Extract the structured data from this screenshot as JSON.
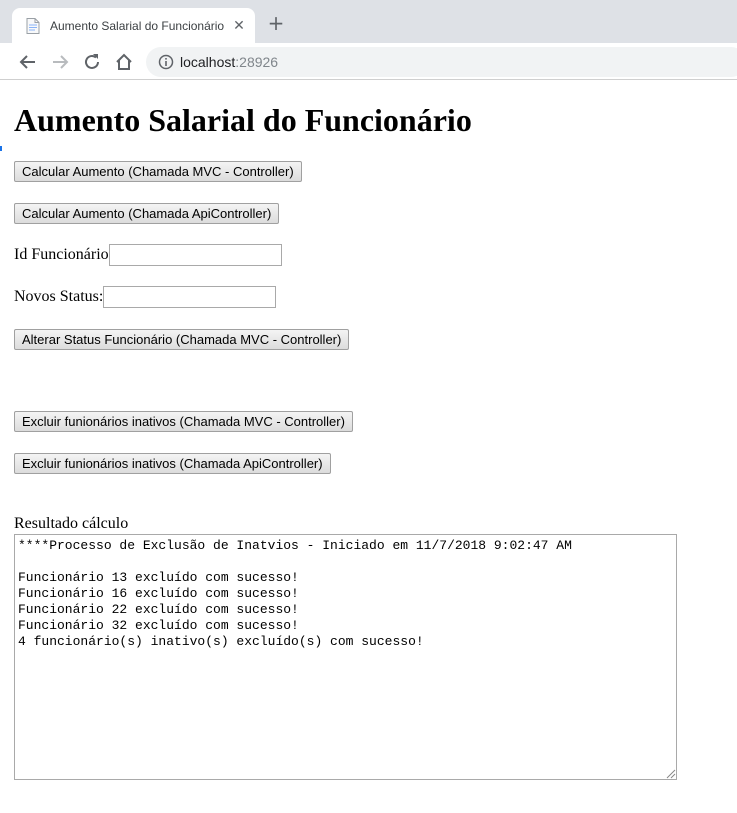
{
  "browser": {
    "tab_title": "Aumento Salarial do Funcionário",
    "tab_close": "✕",
    "new_tab": "+",
    "url_host": "localhost",
    "url_port": ":28926"
  },
  "page": {
    "title": "Aumento Salarial do Funcionário",
    "btn_calc_mvc": "Calcular Aumento (Chamada MVC - Controller)",
    "btn_calc_api": "Calcular Aumento (Chamada ApiController)",
    "label_id": "Id Funcionário:",
    "value_id": "",
    "label_status": "Novos Status:",
    "value_status": "",
    "btn_alterar_mvc": "Alterar Status Funcionário (Chamada MVC - Controller)",
    "btn_excluir_mvc": "Excluir funionários inativos (Chamada MVC - Controller)",
    "btn_excluir_api": "Excluir funionários inativos (Chamada ApiController)",
    "result_label": "Resultado cálculo",
    "result_text": "****Processo de Exclusão de Inatvios - Iniciado em 11/7/2018 9:02:47 AM\n\nFuncionário 13 excluído com sucesso!\nFuncionário 16 excluído com sucesso!\nFuncionário 22 excluído com sucesso!\nFuncionário 32 excluído com sucesso!\n4 funcionário(s) inativo(s) excluído(s) com sucesso!"
  }
}
